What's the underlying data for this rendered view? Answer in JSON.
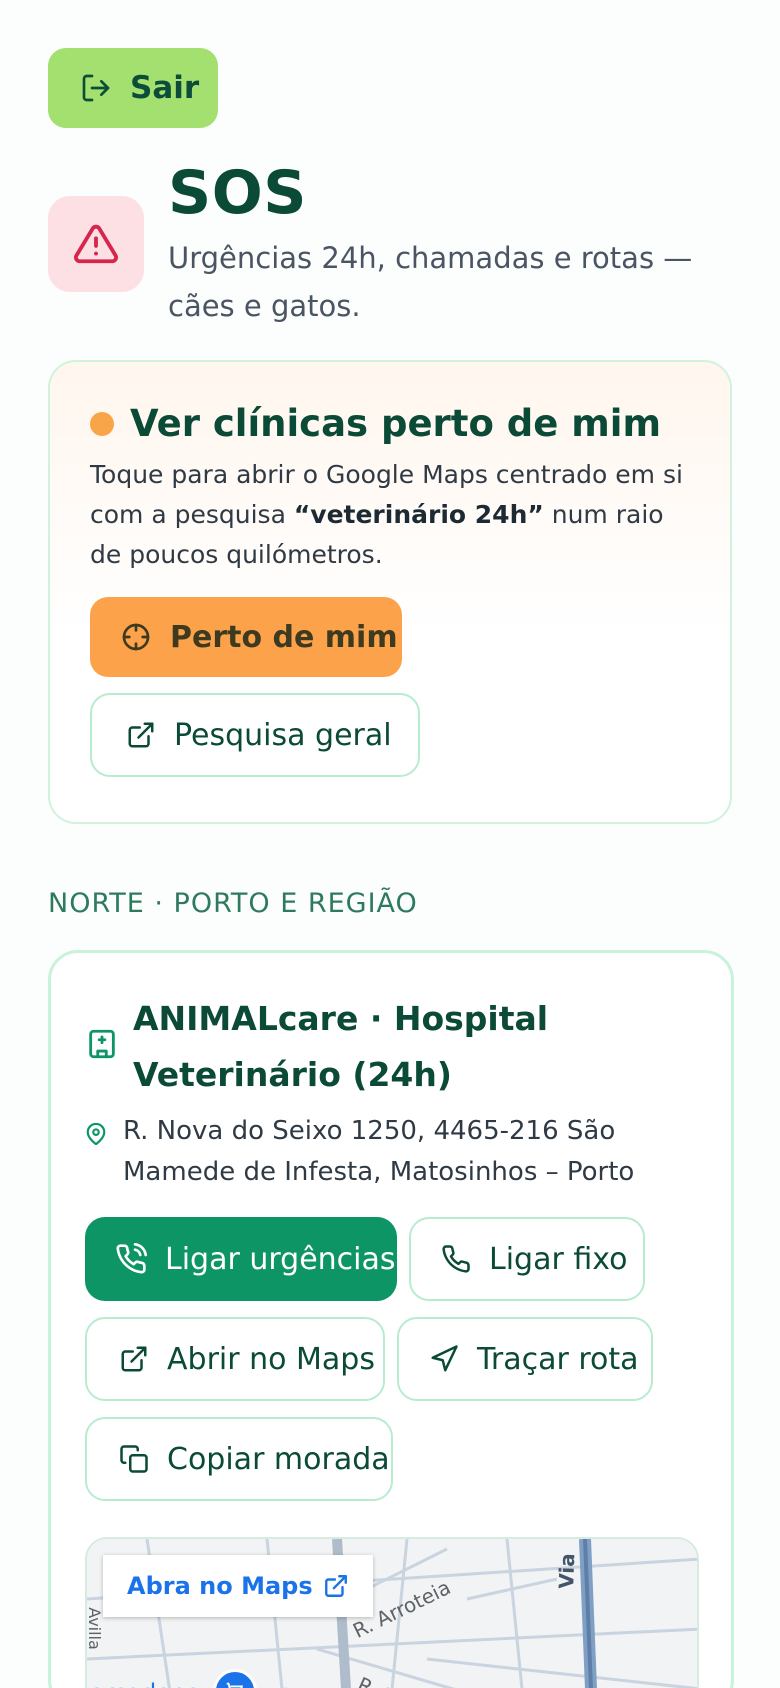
{
  "exit_button": {
    "label": "Sair"
  },
  "header": {
    "title": "SOS",
    "subtitle": "Urgências 24h, chamadas e rotas — cães e gatos."
  },
  "nearby": {
    "title": "Ver clínicas perto de mim",
    "desc_before": "Toque para abrir o Google Maps centrado em si com a pesquisa ",
    "desc_bold": "“veterinário 24h”",
    "desc_after": " num raio de poucos quilómetros.",
    "near_button": "Perto de mim",
    "general_button": "Pesquisa geral"
  },
  "region": {
    "label": "NORTE · PORTO E REGIÃO"
  },
  "clinic": {
    "name": "ANIMALcare · Hospital Veterinário (24h)",
    "address": "R. Nova do Seixo 1250, 4465-216 São Mamede de Infesta, Matosinhos – Porto",
    "actions": {
      "call_emergency": "Ligar urgências",
      "call_landline": "Ligar fixo",
      "open_maps": "Abrir no Maps",
      "route": "Traçar rota",
      "copy_address": "Copiar morada"
    },
    "map": {
      "chip": "Abra no Maps",
      "labels": {
        "street1": "R. Arroteia",
        "street2": "R. Monte",
        "via": "Via",
        "poi": "ercadona",
        "side": "Avilla"
      }
    }
  },
  "colors": {
    "primary_green": "#0e9565",
    "exit_green": "#a3e06f",
    "orange": "#fca24a",
    "danger_bg": "#fde0e3",
    "danger": "#d6264d"
  }
}
